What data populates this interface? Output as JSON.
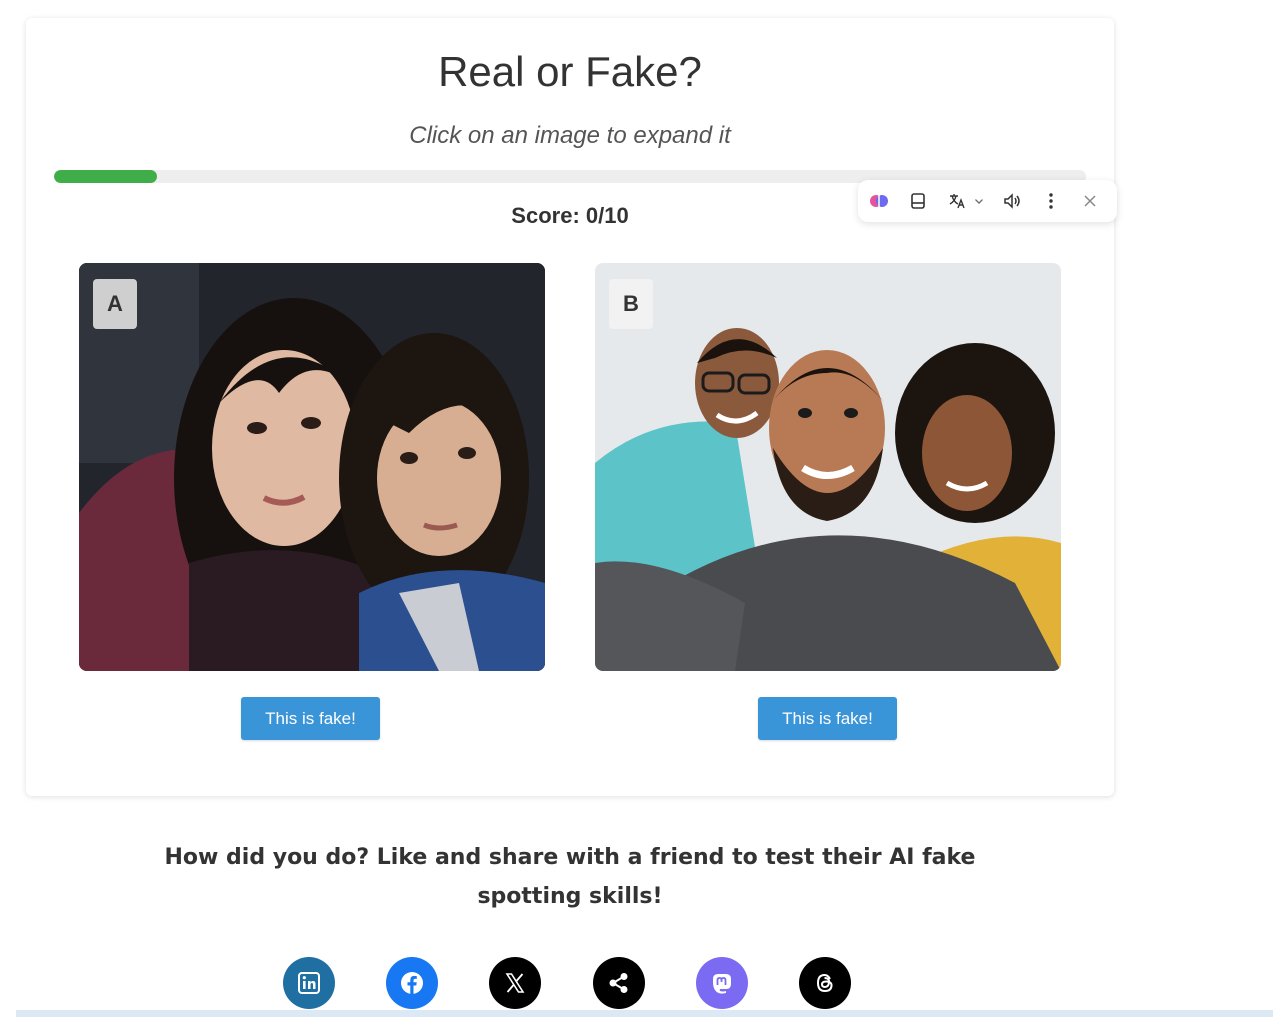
{
  "header": {
    "title": "Real or Fake?",
    "subtitle": "Click on an image to expand it"
  },
  "progress": {
    "fraction": 0.1,
    "color": "#3fae49"
  },
  "score": {
    "text": "Score: 0/10"
  },
  "images": [
    {
      "label": "A",
      "button_label": "This is fake!"
    },
    {
      "label": "B",
      "button_label": "This is fake!"
    }
  ],
  "extension_toolbar": {
    "icons": [
      "brain-icon",
      "reader-icon",
      "translate-icon",
      "chevron-down-icon",
      "speaker-icon",
      "more-vertical-icon",
      "close-icon"
    ]
  },
  "share": {
    "text": "How did you do? Like and share with a friend to test their AI fake spotting skills!",
    "networks": [
      "linkedin",
      "facebook",
      "x",
      "share",
      "mastodon",
      "threads"
    ]
  },
  "colors": {
    "button": "#3a94d8",
    "linkedin": "#1f6fa3",
    "facebook": "#1877f2",
    "mastodon": "#7b6bf2"
  }
}
